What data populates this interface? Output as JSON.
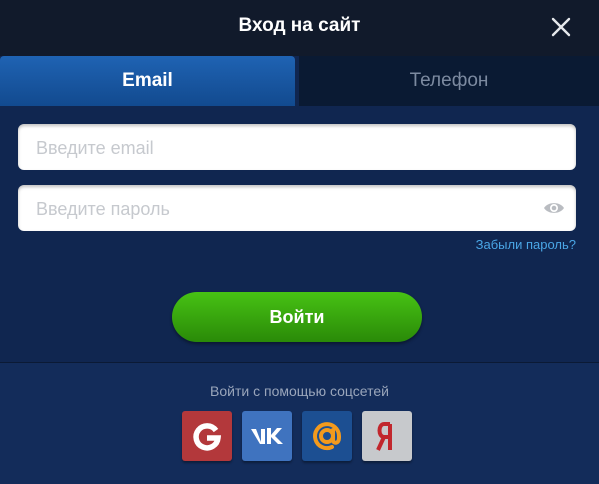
{
  "dialog": {
    "title": "Вход на сайт"
  },
  "tabs": [
    {
      "label": "Email",
      "active": true
    },
    {
      "label": "Телефон",
      "active": false
    }
  ],
  "form": {
    "email_placeholder": "Введите email",
    "email_value": "",
    "password_placeholder": "Введите пароль",
    "password_value": "",
    "forgot_link": "Забыли пароль?",
    "submit_label": "Войти"
  },
  "social": {
    "caption": "Войти с помощью соцсетей",
    "providers": [
      {
        "name": "Google",
        "icon": "google-icon",
        "color": "#b3383b"
      },
      {
        "name": "VK",
        "icon": "vk-icon",
        "color": "#3f73bf"
      },
      {
        "name": "Mail.ru",
        "icon": "at-icon",
        "color": "#1c4f92"
      },
      {
        "name": "Yandex",
        "icon": "yandex-icon",
        "color": "#c7c9cc"
      }
    ]
  },
  "colors": {
    "background": "#102650",
    "titlebar": "#111a2b",
    "active_tab": "#1f63b3",
    "submit": "#47c214",
    "link": "#4aa6e6"
  }
}
